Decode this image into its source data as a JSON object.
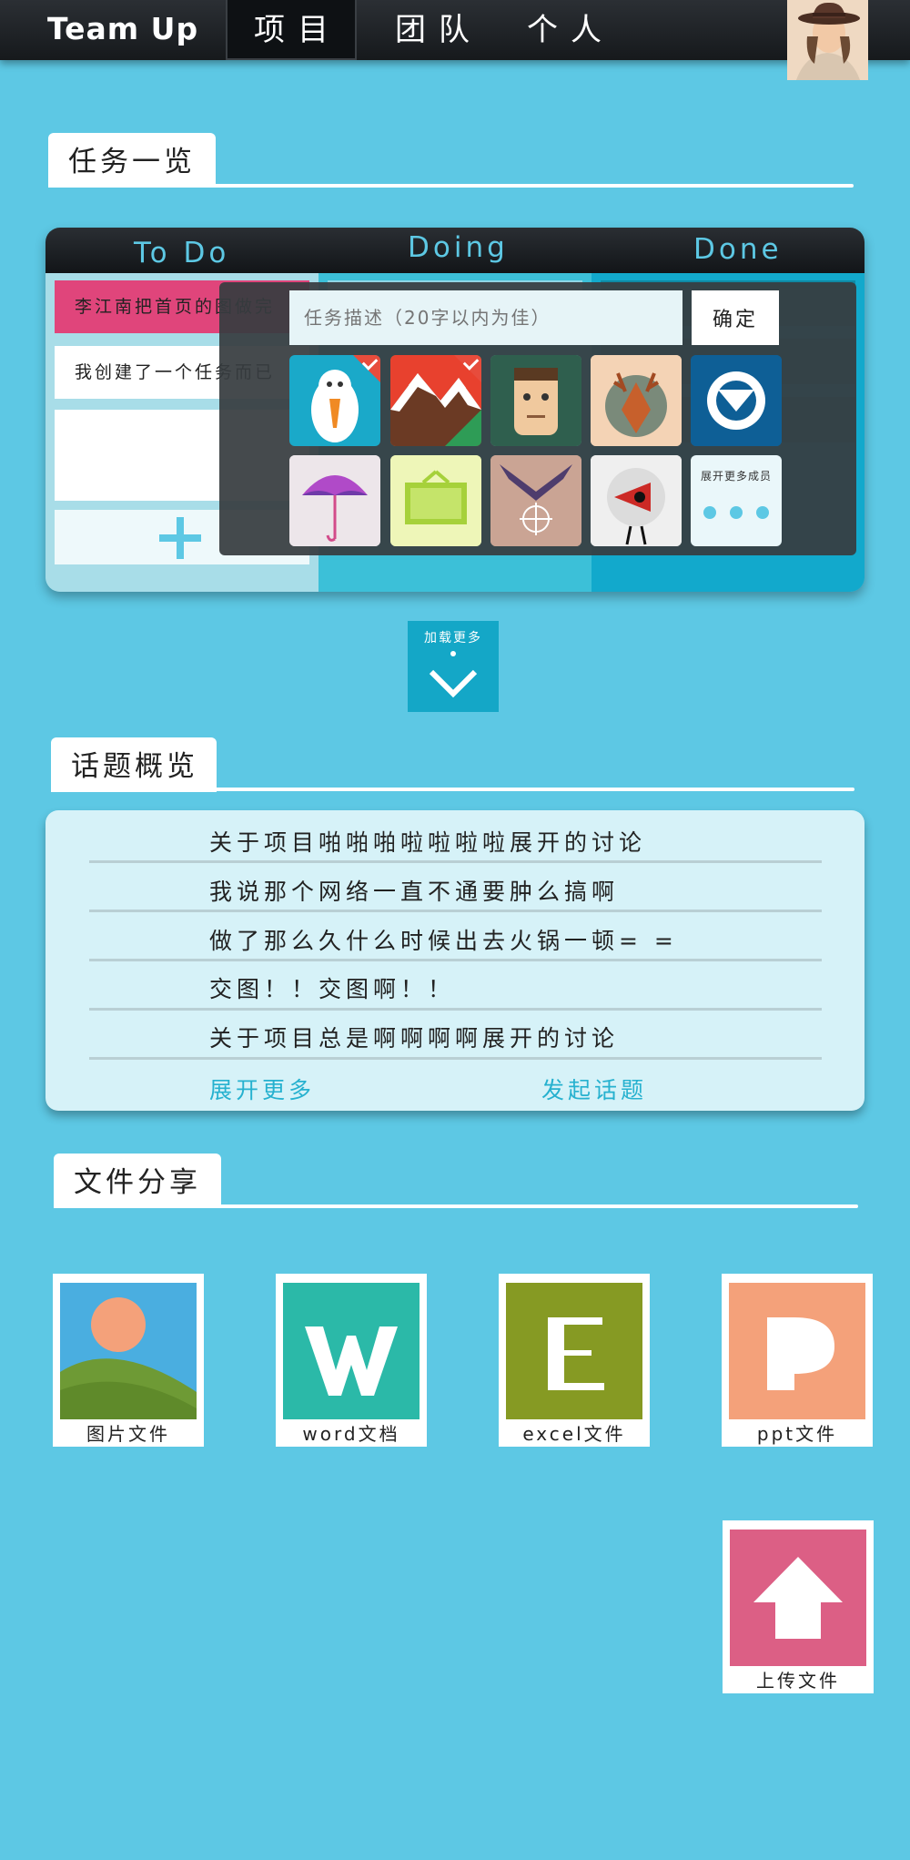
{
  "header": {
    "brand": "Team Up",
    "nav": [
      "项目",
      "团队",
      "个人"
    ]
  },
  "tasks": {
    "section_title": "任务一览",
    "columns": [
      "To Do",
      "Doing",
      "Done"
    ],
    "todo_cards": [
      "李江南把首页的图做完",
      "我创建了一个任务而已"
    ],
    "overlay": {
      "input_placeholder": "任务描述（20字以内为佳）",
      "confirm_label": "确定",
      "more_members_label": "展开更多成员"
    },
    "load_more_label": "加载更多"
  },
  "topics": {
    "section_title": "话题概览",
    "items": [
      "关于项目啪啪啪啦啦啦啦展开的讨论",
      "我说那个网络一直不通要肿么搞啊",
      "做了那么久什么时候出去火锅一顿= =",
      "交图！！交图啊！！",
      "关于项目总是啊啊啊啊展开的讨论"
    ],
    "expand_label": "展开更多",
    "new_topic_label": "发起话题"
  },
  "files": {
    "section_title": "文件分享",
    "items": [
      {
        "label": "图片文件",
        "icon": "image-file-icon",
        "color": "#4aaee0"
      },
      {
        "label": "word文档",
        "icon": "word-file-icon",
        "color": "#2bb9a8"
      },
      {
        "label": "excel文件",
        "icon": "excel-file-icon",
        "color": "#869a23"
      },
      {
        "label": "ppt文件",
        "icon": "ppt-file-icon",
        "color": "#f4a17a"
      }
    ],
    "upload_label": "上传文件",
    "upload_color": "#dc5f85"
  },
  "colors": {
    "background": "#5dc8e4",
    "accent": "#14a7c7",
    "pink": "#e0457b"
  }
}
